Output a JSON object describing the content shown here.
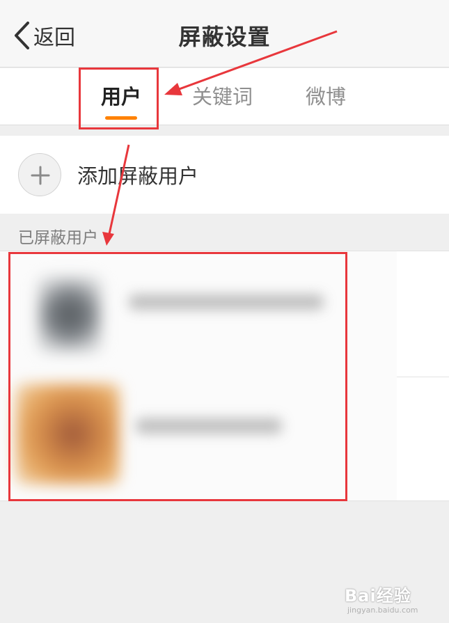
{
  "nav": {
    "back_label": "返回",
    "title": "屏蔽设置"
  },
  "tabs": [
    {
      "label": "用户",
      "active": true
    },
    {
      "label": "关键词",
      "active": false
    },
    {
      "label": "微博",
      "active": false
    }
  ],
  "add_row": {
    "label": "添加屏蔽用户"
  },
  "section": {
    "header": "已屏蔽用户"
  },
  "colors": {
    "accent": "#ff8200",
    "annotation": "#e8373c"
  },
  "icons": {
    "back": "chevron-left-icon",
    "add": "plus-icon"
  },
  "watermark": {
    "logo": "Bai经验",
    "sub": "jingyan.baidu.com"
  }
}
